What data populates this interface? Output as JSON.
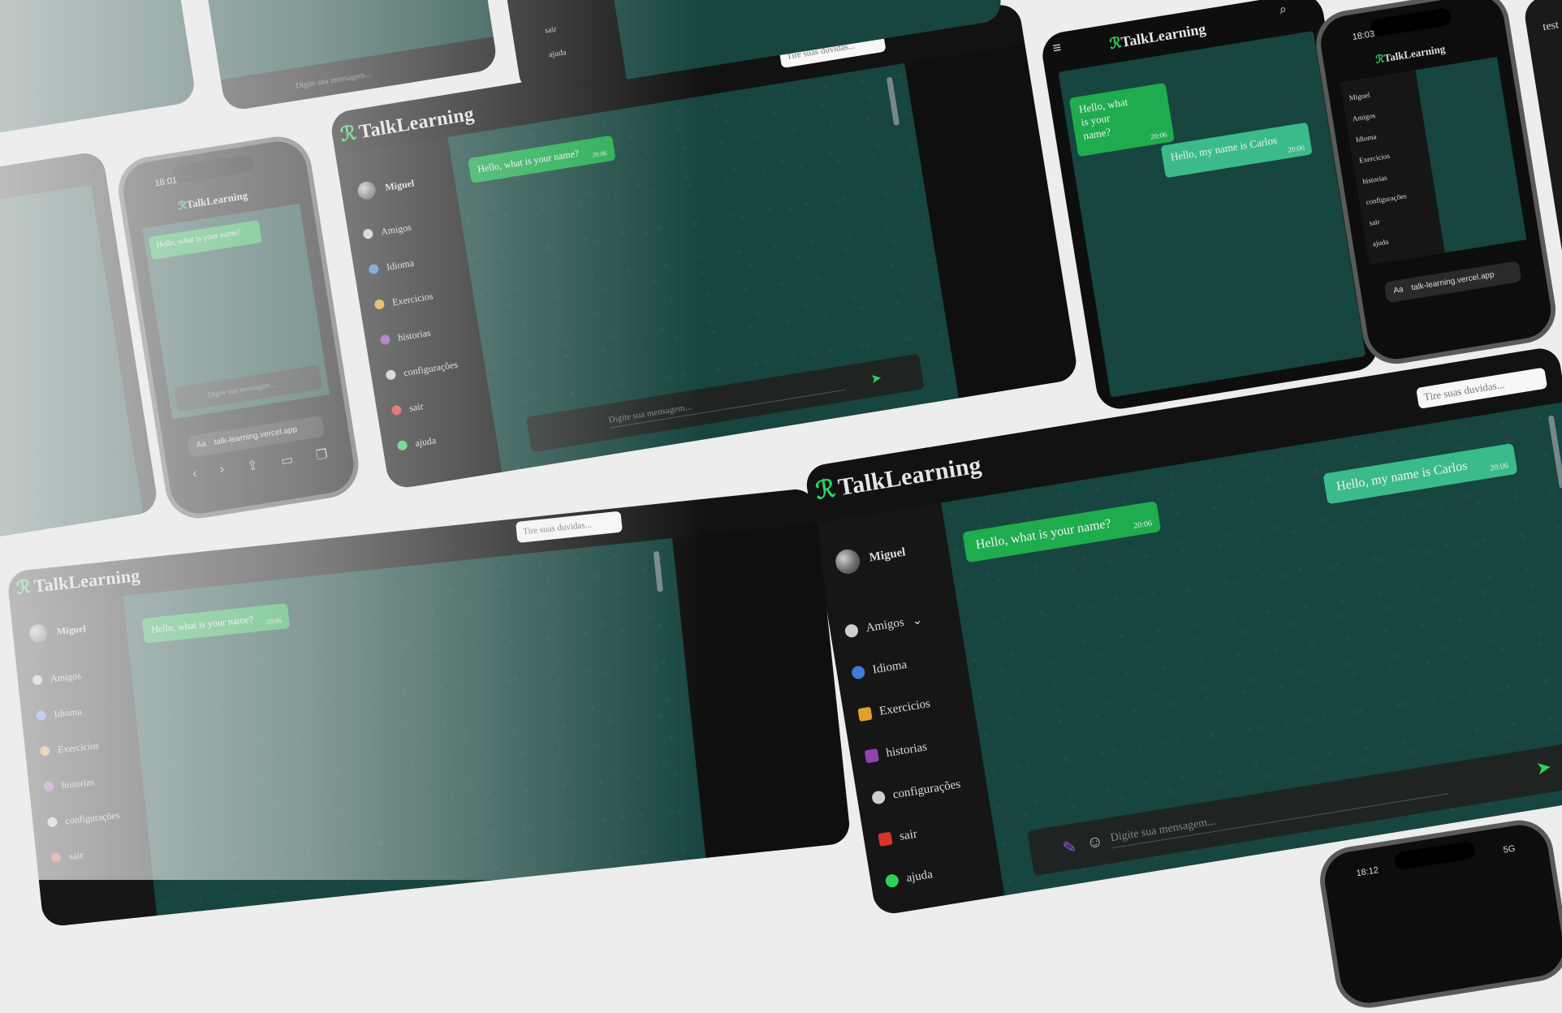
{
  "app": {
    "brand": "TalkLearning",
    "user_name": "Miguel",
    "search_placeholder": "Tire suas duvidas...",
    "composer_placeholder": "Digite sua mensagem...",
    "url": "talk-learning.vercel.app",
    "url_aa": "Aa",
    "sidebar": [
      {
        "label": "Amigos",
        "icon": "friends-icon",
        "color": "#cfcfcf"
      },
      {
        "label": "Idioma",
        "icon": "globe-icon",
        "color": "#3f7bd9"
      },
      {
        "label": "Exercicios",
        "icon": "pencil-icon",
        "color": "#e0a12a"
      },
      {
        "label": "historias",
        "icon": "book-icon",
        "color": "#8e44ad"
      },
      {
        "label": "configurações",
        "icon": "gear-icon",
        "color": "#cfcfcf"
      },
      {
        "label": "sair",
        "icon": "logout-icon",
        "color": "#d9342b"
      },
      {
        "label": "ajuda",
        "icon": "help-icon",
        "color": "#2ed158"
      }
    ],
    "messages": [
      {
        "text": "Hello, what is your name?",
        "time": "20:06",
        "direction": "out"
      },
      {
        "text": "Hello, my name is Carlos",
        "time": "20:06",
        "direction": "in"
      }
    ],
    "phone_status_time": "18:03",
    "phone_status_time_2": "18:01",
    "phone_status_time_3": "18:12",
    "phone_network": "5G",
    "edge_text": "test"
  }
}
